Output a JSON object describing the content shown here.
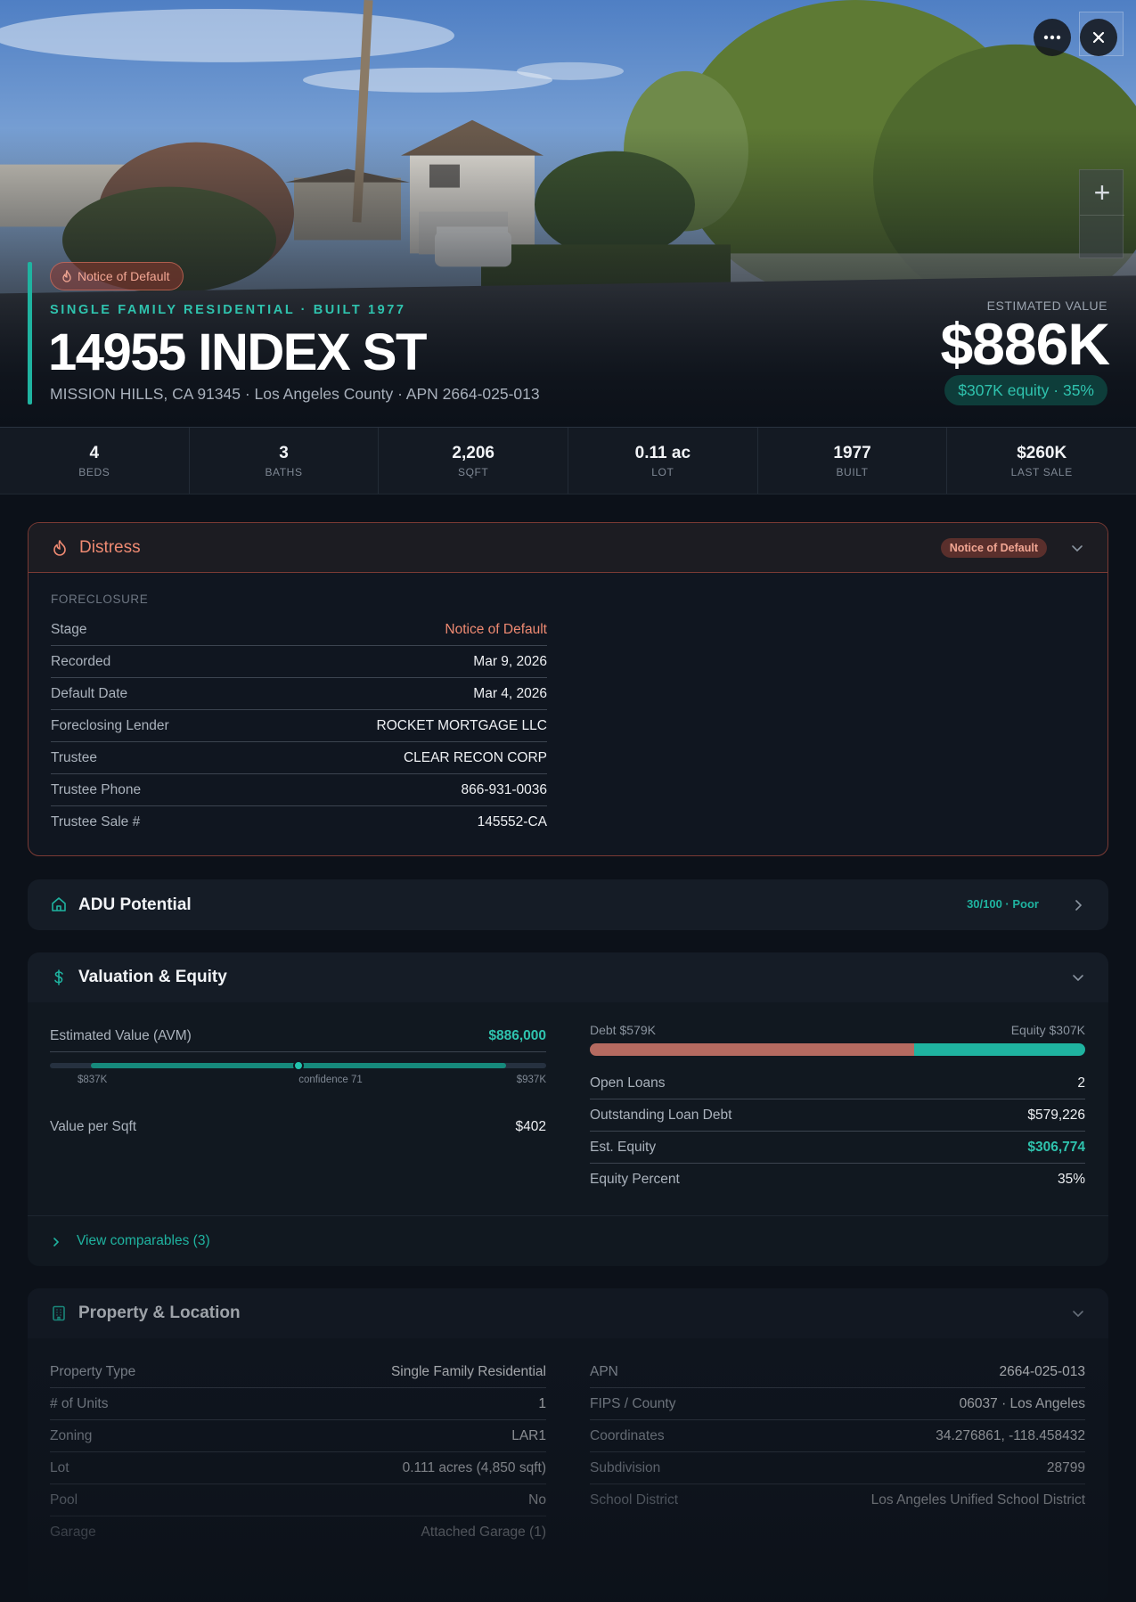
{
  "header": {
    "badge": "Notice of Default",
    "subline": "SINGLE FAMILY RESIDENTIAL · BUILT 1977",
    "title": "14955 INDEX ST",
    "address": "MISSION HILLS, CA 91345 · Los Angeles County · APN 2664-025-013",
    "estimated_label": "ESTIMATED VALUE",
    "estimated_value": "$886K",
    "equity_pill": "$307K equity · 35%"
  },
  "stats": [
    {
      "value": "4",
      "label": "BEDS"
    },
    {
      "value": "3",
      "label": "BATHS"
    },
    {
      "value": "2,206",
      "label": "SQFT"
    },
    {
      "value": "0.11 ac",
      "label": "LOT"
    },
    {
      "value": "1977",
      "label": "BUILT"
    },
    {
      "value": "$260K",
      "label": "LAST SALE"
    }
  ],
  "distress": {
    "title": "Distress",
    "badge": "Notice of Default",
    "section_label": "FORECLOSURE",
    "rows": [
      {
        "label": "Stage",
        "value": "Notice of Default"
      },
      {
        "label": "Recorded",
        "value": "Mar 9, 2026"
      },
      {
        "label": "Default Date",
        "value": "Mar 4, 2026"
      },
      {
        "label": "Foreclosing Lender",
        "value": "ROCKET MORTGAGE LLC"
      },
      {
        "label": "Trustee",
        "value": "CLEAR RECON CORP"
      },
      {
        "label": "Trustee Phone",
        "value": "866-931-0036"
      },
      {
        "label": "Trustee Sale #",
        "value": "145552-CA"
      }
    ]
  },
  "adu": {
    "title": "ADU Potential",
    "score": "30/100 · Poor"
  },
  "valuation": {
    "title": "Valuation & Equity",
    "avm_label": "Estimated Value (AVM)",
    "avm_value": "$886,000",
    "range_low": "$837K",
    "range_mid": "confidence 71",
    "range_high": "$937K",
    "range_position": 0.5,
    "value_sqft_label": "Value per Sqft",
    "value_sqft": "$402",
    "debt_label": "Debt $579K",
    "equity_label": "Equity $307K",
    "debt_fraction": 0.654,
    "rows": [
      {
        "label": "Open Loans",
        "value": "2"
      },
      {
        "label": "Outstanding Loan Debt",
        "value": "$579,226"
      },
      {
        "label": "Est. Equity",
        "value": "$306,774"
      },
      {
        "label": "Equity Percent",
        "value": "35%"
      }
    ],
    "comps_link": "View comparables (3)"
  },
  "property": {
    "title": "Property & Location",
    "left_rows": [
      {
        "label": "Property Type",
        "value": "Single Family Residential"
      },
      {
        "label": "# of Units",
        "value": "1"
      },
      {
        "label": "Zoning",
        "value": "LAR1"
      },
      {
        "label": "Lot",
        "value": "0.111 acres (4,850 sqft)"
      },
      {
        "label": "Pool",
        "value": "No"
      },
      {
        "label": "Garage",
        "value": "Attached Garage (1)"
      }
    ],
    "right_rows": [
      {
        "label": "APN",
        "value": "2664-025-013"
      },
      {
        "label": "FIPS / County",
        "value": "06037 · Los Angeles"
      },
      {
        "label": "Coordinates",
        "value": "34.276861, -118.458432"
      },
      {
        "label": "Subdivision",
        "value": "28799"
      },
      {
        "label": "School District",
        "value": "Los Angeles Unified School District"
      }
    ]
  },
  "colors": {
    "accent": "#1fb3a0",
    "distress": "#ef8a72",
    "debt": "#b56a60"
  }
}
